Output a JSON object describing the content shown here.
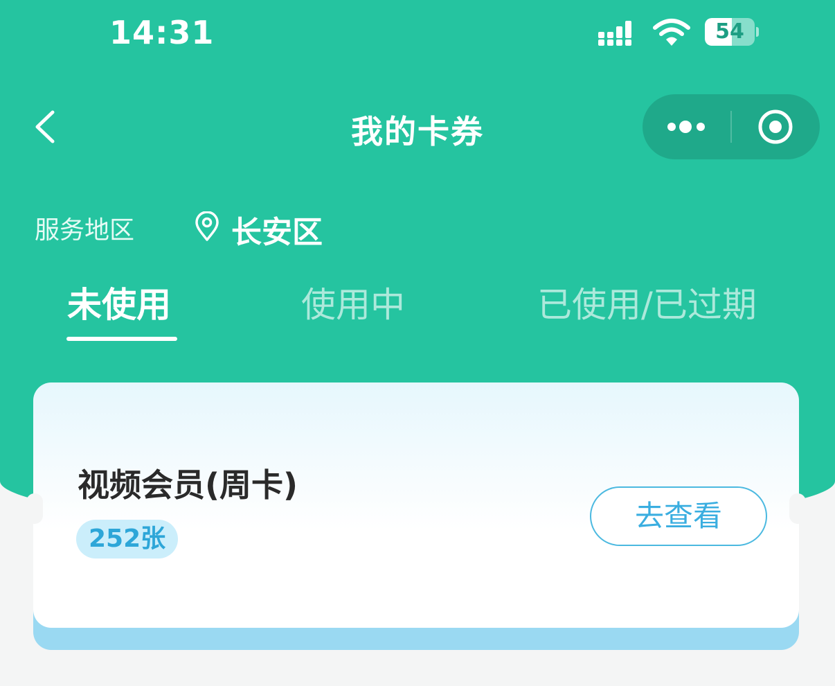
{
  "status_bar": {
    "time": "14:31",
    "battery_level": "54",
    "icons": [
      "cellular-signal-icon",
      "wifi-icon",
      "battery-icon"
    ]
  },
  "nav": {
    "title": "我的卡券",
    "back_icon": "chevron-left-icon",
    "more_icon": "more-dots-icon",
    "close_icon": "target-circle-icon"
  },
  "region": {
    "label": "服务地区",
    "value": "长安区",
    "icon": "location-pin-icon"
  },
  "tabs": [
    {
      "label": "未使用",
      "active": true
    },
    {
      "label": "使用中",
      "active": false
    },
    {
      "label": "已使用/已过期",
      "active": false
    }
  ],
  "coupon": {
    "title": "视频会员(周卡)",
    "count": "252张",
    "action": "去查看"
  },
  "colors": {
    "primary_green": "#25c4a0",
    "accent_blue": "#3aaee0",
    "badge_bg": "#cbeefb",
    "card_base": "#9ad9f2",
    "page_bg": "#f4f5f5"
  }
}
